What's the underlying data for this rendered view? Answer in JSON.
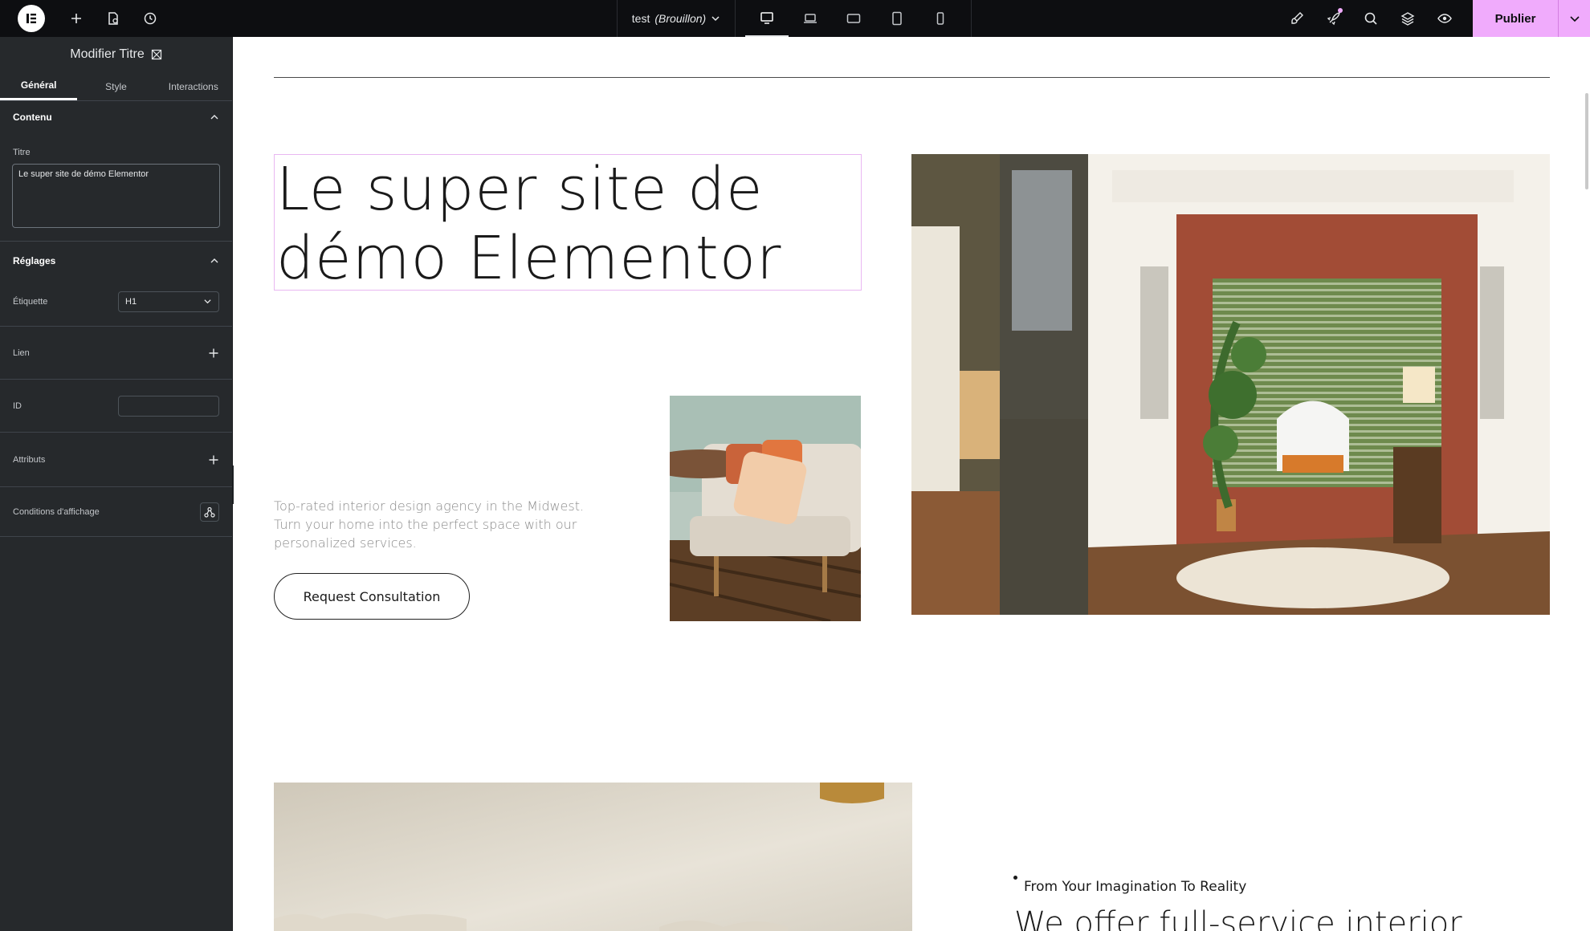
{
  "topbar": {
    "doc_name": "test",
    "doc_status": "(Brouillon)",
    "publish_label": "Publier"
  },
  "panel": {
    "title": "Modifier Titre",
    "tabs": [
      {
        "label": "Général",
        "active": true
      },
      {
        "label": "Style",
        "active": false
      },
      {
        "label": "Interactions",
        "active": false
      }
    ],
    "content_section": "Contenu",
    "title_label": "Titre",
    "title_value": "Le super site de démo Elementor",
    "settings_section": "Réglages",
    "tag_label": "Étiquette",
    "tag_value": "H1",
    "link_label": "Lien",
    "id_label": "ID",
    "attributes_label": "Attributs",
    "conditions_label": "Conditions d'affichage"
  },
  "canvas": {
    "hero_title": "Le super site de démo Elementor",
    "hero_text": "Top-rated interior design agency in the Midwest. Turn your home into the perfect space with our personalized services.",
    "cta_label": "Request Consultation",
    "subhead": "From Your Imagination To Reality",
    "bottom_heading": "We offer full-service interior"
  },
  "colors": {
    "accent": "#f0abfc",
    "topbar_bg": "#0d0e11",
    "panel_bg": "#26292c"
  }
}
